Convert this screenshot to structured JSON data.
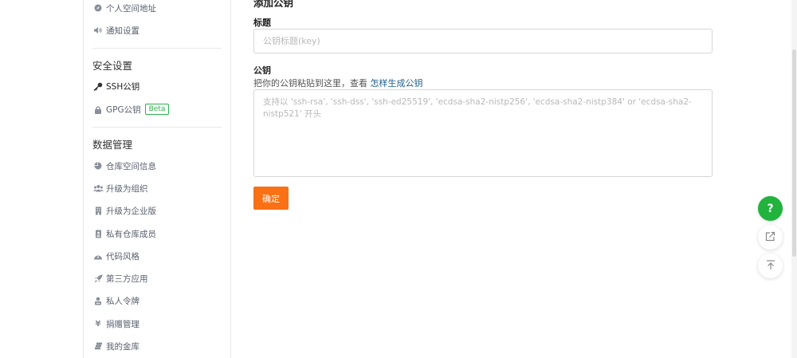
{
  "sidebar": {
    "top_items": [
      {
        "label": "个人空间地址",
        "icon": "compass-icon"
      },
      {
        "label": "通知设置",
        "icon": "volume-icon"
      }
    ],
    "security": {
      "title": "安全设置",
      "ssh_label": "SSH公钥",
      "gpg_label": "GPG公钥",
      "gpg_badge": "Beta"
    },
    "data": {
      "title": "数据管理",
      "items": [
        {
          "label": "仓库空间信息",
          "icon": "pie-chart-icon"
        },
        {
          "label": "升级为组织",
          "icon": "users-icon"
        },
        {
          "label": "升级为企业版",
          "icon": "building-icon"
        },
        {
          "label": "私有仓库成员",
          "icon": "id-card-icon"
        },
        {
          "label": "代码风格",
          "icon": "palette-icon"
        },
        {
          "label": "第三方应用",
          "icon": "rocket-icon"
        },
        {
          "label": "私人令牌",
          "icon": "token-icon"
        },
        {
          "label": "捐赠管理",
          "icon": "yen-icon"
        },
        {
          "label": "我的金库",
          "icon": "coins-icon"
        }
      ]
    }
  },
  "main": {
    "title": "添加公钥",
    "title_label": "标题",
    "title_placeholder": "公钥标题(key)",
    "key_label": "公钥",
    "hint_prefix": "把你的公钥粘贴到这里，查看",
    "hint_link": "怎样生成公钥",
    "key_placeholder": "支持以 'ssh-rsa', 'ssh-dss', 'ssh-ed25519', 'ecdsa-sha2-nistp256', 'ecdsa-sha2-nistp384' or 'ecdsa-sha2-nistp521' 开头",
    "confirm_label": "确定"
  },
  "floating": {
    "help_label": "?"
  },
  "colors": {
    "accent": "#fa7014",
    "help_green": "#21b33d",
    "link": "#1f5e8c",
    "beta_green": "#2cb34a"
  }
}
